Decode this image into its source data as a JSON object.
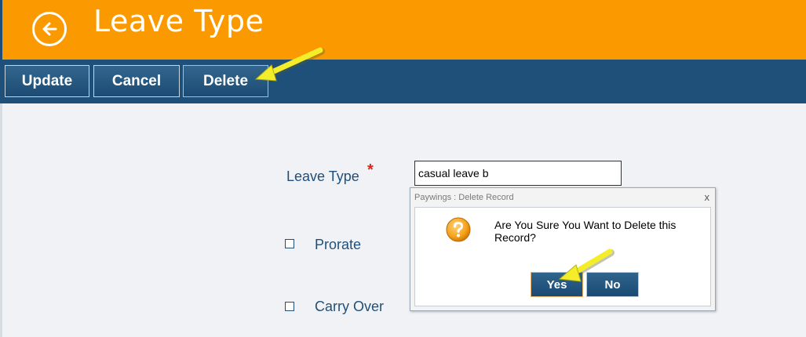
{
  "header": {
    "title": "Leave Type",
    "back_icon": "arrow-left-circle-icon"
  },
  "toolbar": {
    "update_label": "Update",
    "cancel_label": "Cancel",
    "delete_label": "Delete"
  },
  "form": {
    "leave_type_label": "Leave Type",
    "required_marker": "*",
    "leave_type_value": "casual leave b",
    "prorate_label": "Prorate",
    "prorate_checked": false,
    "carry_over_label": "Carry Over",
    "carry_over_checked": false
  },
  "dialog": {
    "title": "Paywings : Delete Record",
    "close_glyph": "x",
    "message": "Are You Sure You Want to Delete this Record?",
    "icon": "question-icon",
    "yes_label": "Yes",
    "no_label": "No"
  },
  "colors": {
    "header_bg": "#fb9a00",
    "toolbar_bg": "#1f5079",
    "label_text": "#1f4f7a",
    "required": "#d9251d",
    "annotation_arrow": "#f7f12d"
  }
}
